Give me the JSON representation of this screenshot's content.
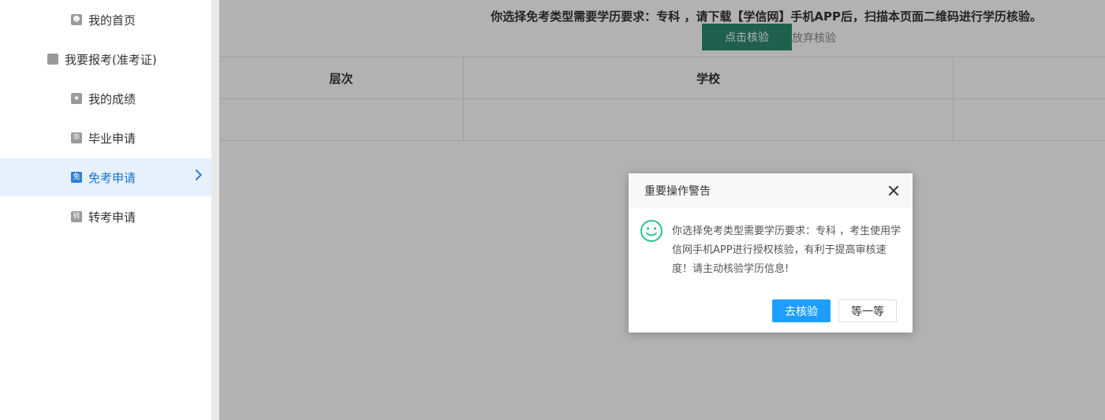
{
  "sidebar": {
    "items": [
      {
        "label": "我的首页",
        "icon": "user-icon",
        "icon_char": ""
      },
      {
        "label": "我要报考(准考证)",
        "icon": "card-icon",
        "icon_char": ""
      },
      {
        "label": "我的成绩",
        "icon": "medal-icon",
        "icon_char": ""
      },
      {
        "label": "毕业申请",
        "icon": "graduate-icon",
        "icon_char": "毕"
      },
      {
        "label": "免考申请",
        "icon": "exempt-icon",
        "icon_char": "免"
      },
      {
        "label": "转考申请",
        "icon": "transfer-icon",
        "icon_char": "转"
      }
    ]
  },
  "main": {
    "notice": "你选择免考类型需要学历要求：专科 ，请下载【学信网】手机APP后，扫描本页面二维码进行学历核验。",
    "verify_button": "点击核验",
    "abandon_link": "放弃核验",
    "table": {
      "headers": [
        "层次",
        "学校",
        ""
      ],
      "rows": [
        [
          "",
          "",
          ""
        ]
      ]
    }
  },
  "dialog": {
    "title": "重要操作警告",
    "message": "你选择免考类型需要学历要求：专科 ，考生使用学信网手机APP进行授权核验，有利于提高审核速度！请主动核验学历信息!",
    "primary_button": "去核验",
    "secondary_button": "等一等"
  },
  "colors": {
    "active_accent": "#2f7fd6",
    "verify_button": "#2b8a6e",
    "primary_button": "#1e9fff",
    "smile_icon": "#2bc48a"
  }
}
